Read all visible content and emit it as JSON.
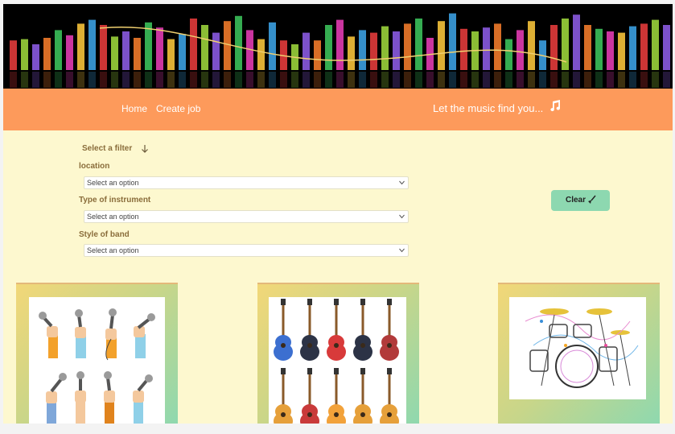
{
  "nav": {
    "home_label": "Home",
    "create_job_label": "Create job",
    "tagline": "Let the music find you..."
  },
  "filters": {
    "heading": "Select a filter",
    "location_label": "location",
    "instrument_label": "Type of instrument",
    "band_label": "Style of band",
    "placeholder": "Select an option"
  },
  "clear_button": {
    "label": "Clear"
  },
  "cards": [
    {
      "image": "hands-holding-microphones-illustration"
    },
    {
      "image": "electric-and-acoustic-guitars-illustration"
    },
    {
      "image": "drum-kit-sketch-illustration"
    }
  ],
  "colors": {
    "navbar": "#fd9a5b",
    "background": "#fdf8cf",
    "clear_button": "#8dd8b0",
    "label_text": "#8a6d3b"
  }
}
